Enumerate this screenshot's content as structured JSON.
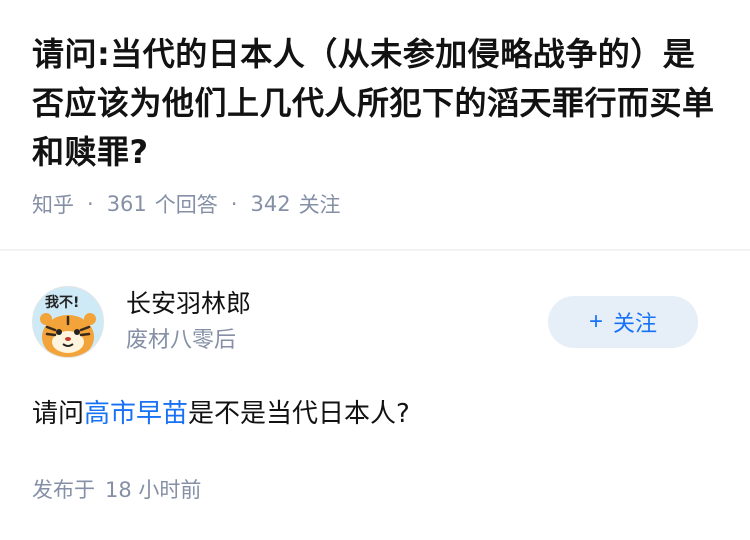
{
  "question": {
    "title": "请问:当代的日本人（从未参加侵略战争的）是否应该为他们上几代人所犯下的滔天罪行而买单和赎罪?",
    "source": "知乎",
    "answers_count": "361",
    "answers_label": "个回答",
    "followers_count": "342",
    "followers_label": "关注",
    "separator": "·"
  },
  "answer": {
    "author_name": "长安羽林郎",
    "author_bio": "废材八零后",
    "avatar_icon": "cartoon-tiger-avatar-icon",
    "avatar_text": "我不!",
    "follow_button": {
      "plus": "+",
      "label": "关注"
    },
    "content_prefix": "请问",
    "content_link": "高市早苗",
    "content_suffix": "是不是当代日本人?",
    "time_label": "发布于",
    "time_value": "18 小时前"
  },
  "colors": {
    "link": "#1772f6",
    "meta_gray": "#8590a6",
    "button_bg": "#e6eef8"
  }
}
